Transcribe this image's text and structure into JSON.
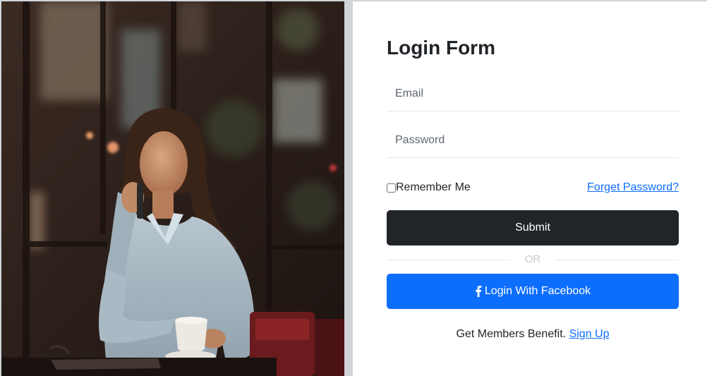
{
  "form": {
    "title": "Login Form",
    "email": {
      "placeholder": "Email"
    },
    "password": {
      "placeholder": "Password"
    },
    "remember": {
      "label": "Remember Me",
      "checked": false
    },
    "forgot_link": "Forget Password?",
    "submit_label": "Submit",
    "divider_text": "OR",
    "facebook": {
      "label": "Login With Facebook",
      "icon": "facebook-icon"
    },
    "footer": {
      "text": "Get Members Benefit.",
      "signup_link": "Sign Up"
    }
  },
  "colors": {
    "submit_bg": "#212529",
    "facebook_bg": "#0d6efd",
    "link": "#0d6efd"
  }
}
